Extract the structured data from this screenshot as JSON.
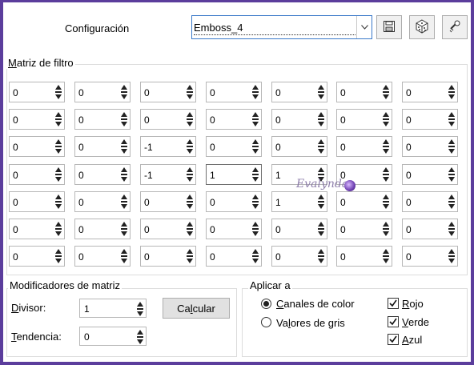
{
  "header": {
    "config_label": "Configuración",
    "preset_value": "Emboss_4"
  },
  "icons": {
    "save": "floppy-disk-icon",
    "random": "dice-icon",
    "reset": "key-reset-icon",
    "dropdown": "chevron-down-icon"
  },
  "matrix": {
    "title": "Matriz de filtro",
    "rows": [
      [
        "0",
        "0",
        "0",
        "0",
        "0",
        "0",
        "0"
      ],
      [
        "0",
        "0",
        "0",
        "0",
        "0",
        "0",
        "0"
      ],
      [
        "0",
        "0",
        "-1",
        "0",
        "0",
        "0",
        "0"
      ],
      [
        "0",
        "0",
        "-1",
        "1",
        "1",
        "0",
        "0"
      ],
      [
        "0",
        "0",
        "0",
        "0",
        "1",
        "0",
        "0"
      ],
      [
        "0",
        "0",
        "0",
        "0",
        "0",
        "0",
        "0"
      ],
      [
        "0",
        "0",
        "0",
        "0",
        "0",
        "0",
        "0"
      ]
    ]
  },
  "modifiers": {
    "title": "Modificadores de matriz",
    "divisor_label": "Divisor:",
    "divisor_value": "1",
    "bias_label": "Tendencia:",
    "bias_value": "0",
    "compute_label": "Calcular"
  },
  "apply": {
    "title": "Aplicar a",
    "color_channels": "Canales de color",
    "gray_values": "Valores de gris",
    "red": "Rojo",
    "green": "Verde",
    "blue": "Azul",
    "selected_mode": "Canales de color",
    "red_checked": true,
    "green_checked": true,
    "blue_checked": true
  },
  "watermark": "Evalynda",
  "colors": {
    "frame": "#5b3d9c",
    "focus_border": "#3a79c9"
  }
}
